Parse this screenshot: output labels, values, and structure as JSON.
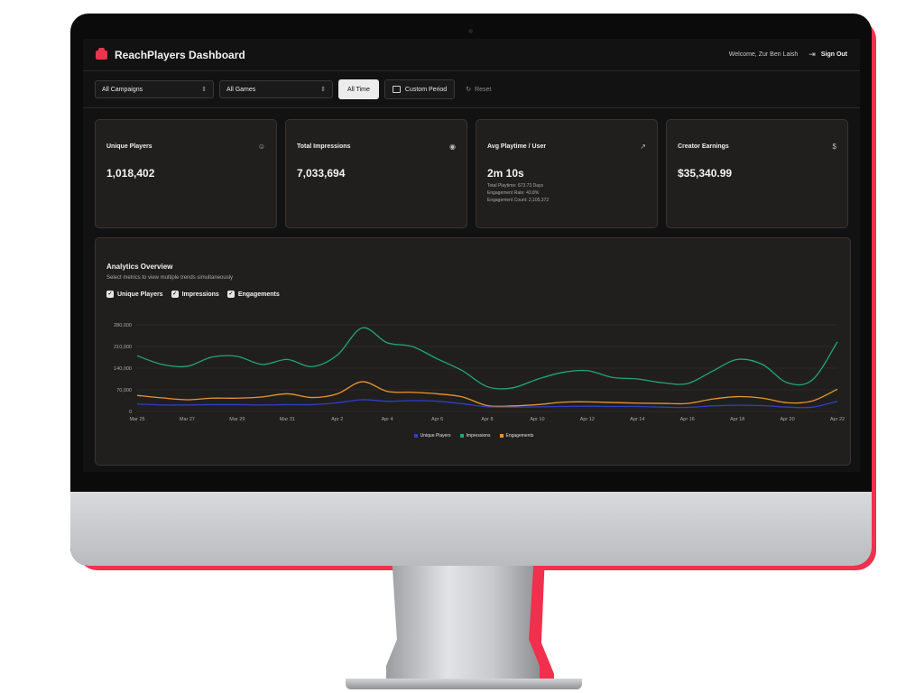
{
  "app": {
    "title": "ReachPlayers Dashboard",
    "welcome": "Welcome, Zur Ben Laish",
    "sign_out": "Sign Out"
  },
  "filters": {
    "campaign": "All Campaigns",
    "game": "All Games",
    "all_time": "All Time",
    "custom_period": "Custom Period",
    "reset": "Reset"
  },
  "cards": [
    {
      "label": "Unique Players",
      "value": "1,018,402",
      "icon": "users-icon"
    },
    {
      "label": "Total Impressions",
      "value": "7,033,694",
      "icon": "eye-icon"
    },
    {
      "label": "Avg Playtime / User",
      "value": "2m 10s",
      "icon": "pointer-icon",
      "details": [
        "Total Playtime: 673.73 Days",
        "Engagement Rate: 43.8%",
        "Engagement Count: 2,105,372"
      ]
    },
    {
      "label": "Creator Earnings",
      "value": "$35,340.99",
      "icon": "dollar-icon"
    }
  ],
  "analytics": {
    "title": "Analytics Overview",
    "subtitle": "Select metrics to view multiple trends simultaneously",
    "toggles": [
      "Unique Players",
      "Impressions",
      "Engagements"
    ]
  },
  "colors": {
    "accent": "#e8344d",
    "unique_players": "#2f3fc9",
    "impressions": "#1fa874",
    "engagements": "#e8962a"
  },
  "chart_data": {
    "type": "line",
    "x": [
      "Mar 25",
      "Mar 26",
      "Mar 27",
      "Mar 28",
      "Mar 29",
      "Mar 30",
      "Mar 31",
      "Apr 1",
      "Apr 2",
      "Apr 3",
      "Apr 4",
      "Apr 5",
      "Apr 6",
      "Apr 7",
      "Apr 8",
      "Apr 9",
      "Apr 10",
      "Apr 11",
      "Apr 12",
      "Apr 13",
      "Apr 14",
      "Apr 15",
      "Apr 16",
      "Apr 17",
      "Apr 18",
      "Apr 19",
      "Apr 20",
      "Apr 21",
      "Apr 22"
    ],
    "x_tick_labels": [
      "Mar 25",
      "Mar 27",
      "Mar 29",
      "Mar 31",
      "Apr 2",
      "Apr 4",
      "Apr 6",
      "Apr 8",
      "Apr 10",
      "Apr 12",
      "Apr 14",
      "Apr 16",
      "Apr 18",
      "Apr 20",
      "Apr 22"
    ],
    "y_ticks": [
      0,
      70000,
      140000,
      210000,
      280000
    ],
    "y_tick_labels": [
      "0",
      "70,000",
      "140,000",
      "210,000",
      "280,000"
    ],
    "ylim": [
      0,
      280000
    ],
    "grid": true,
    "legend": "bottom-center",
    "series": [
      {
        "name": "Unique Players",
        "values": [
          24000,
          21000,
          21000,
          22000,
          22000,
          21000,
          22000,
          22000,
          28000,
          38000,
          33000,
          35000,
          33000,
          25000,
          15000,
          14000,
          15000,
          16000,
          17000,
          16000,
          16000,
          14000,
          13000,
          18000,
          20000,
          19000,
          14000,
          14000,
          33000
        ]
      },
      {
        "name": "Impressions",
        "values": [
          180000,
          152000,
          146000,
          176000,
          178000,
          152000,
          168000,
          145000,
          182000,
          270000,
          222000,
          210000,
          170000,
          132000,
          80000,
          76000,
          104000,
          126000,
          132000,
          110000,
          105000,
          93000,
          90000,
          130000,
          168000,
          152000,
          93000,
          102000,
          225000
        ]
      },
      {
        "name": "Engagements",
        "values": [
          52000,
          44000,
          38000,
          43000,
          43000,
          47000,
          57000,
          45000,
          57000,
          96000,
          65000,
          62000,
          57000,
          47000,
          19000,
          18000,
          22000,
          30000,
          31000,
          29000,
          27000,
          26000,
          26000,
          40000,
          48000,
          43000,
          28000,
          34000,
          72000
        ]
      }
    ]
  }
}
